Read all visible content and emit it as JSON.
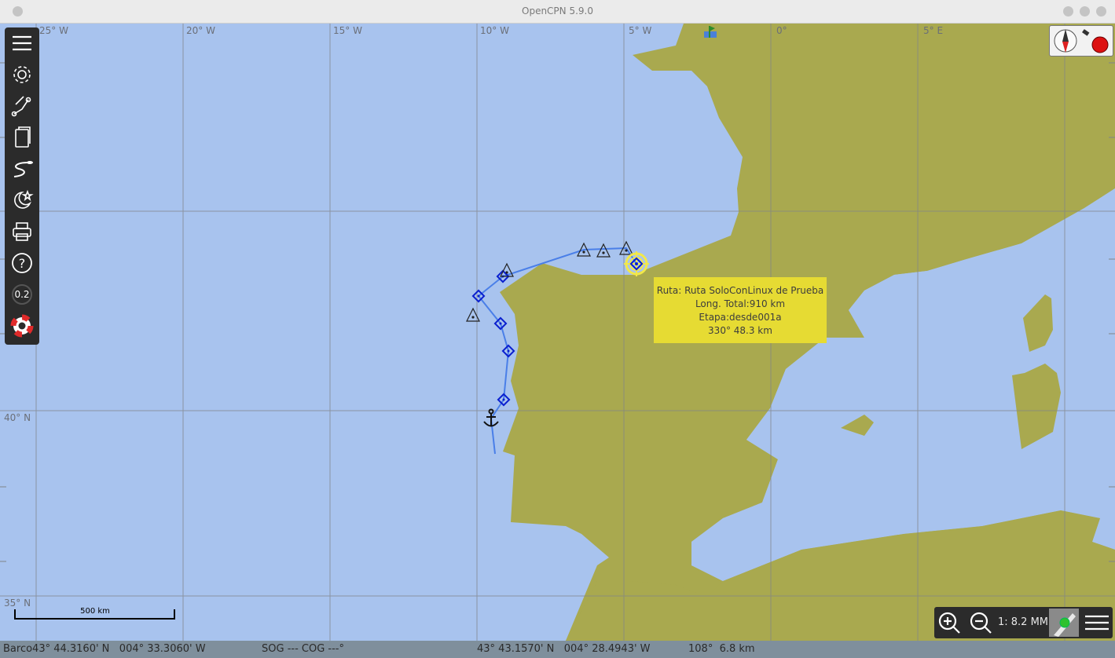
{
  "window": {
    "title": "OpenCPN 5.9.0"
  },
  "grid": {
    "longitude_labels": [
      "25° W",
      "20° W",
      "15° W",
      "10° W",
      "5° W",
      "0°",
      "5° E"
    ],
    "latitude_labels": [
      "40° N",
      "35° N"
    ]
  },
  "toolbar": {
    "items": [
      {
        "name": "menu-icon"
      },
      {
        "name": "settings-gear-icon"
      },
      {
        "name": "route-manager-icon"
      },
      {
        "name": "chart-info-icon"
      },
      {
        "name": "track-icon"
      },
      {
        "name": "day-night-icon"
      },
      {
        "name": "print-icon"
      },
      {
        "name": "help-icon"
      },
      {
        "name": "mob-icon"
      }
    ],
    "level_label": "0.2"
  },
  "route_tooltip": {
    "line1": "Ruta: Ruta SoloConLinux de Prueba",
    "line2": "Long. Total:910 km",
    "line3": "Etapa:desde001a",
    "line4": "330° 48.3 km"
  },
  "scale": {
    "bar_label": "500 km",
    "zoom_text": "1: 8.2 MM"
  },
  "status": {
    "ship": "Barco43° 44.3160' N   004° 33.3060' W",
    "sog_cog": "SOG --- COG ---°",
    "cursor": "43° 43.1570' N   004° 28.4943' W",
    "bearing": "108°  6.8 km"
  },
  "colors": {
    "sea": "#a8c3ee",
    "land": "#a9a94f",
    "route": "#4a7fe8",
    "waypoint": "#0a1fcf",
    "tooltip": "#e6db33"
  }
}
